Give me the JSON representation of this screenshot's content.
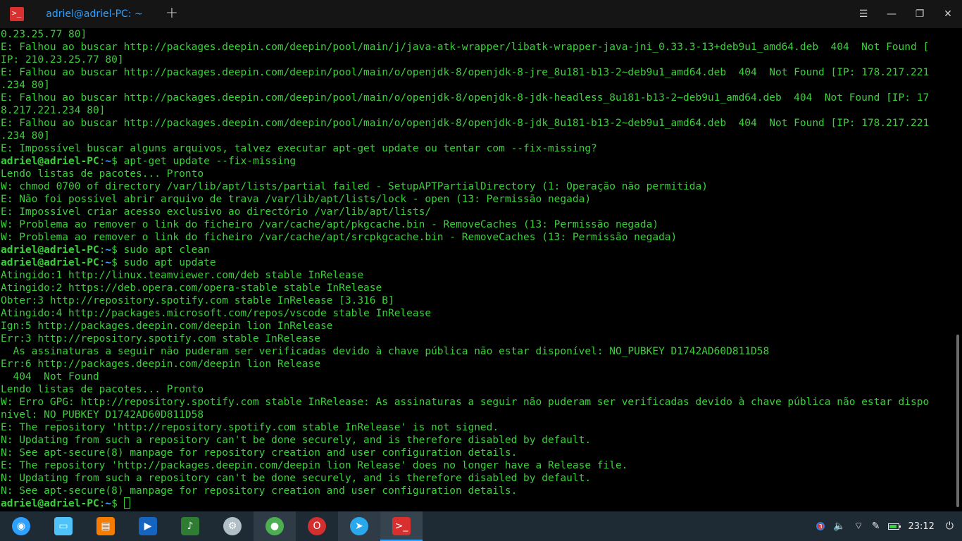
{
  "window": {
    "tab_title": "adriel@adriel-PC: ~",
    "new_tab_symbol": "+",
    "menu_symbol": "☰",
    "minimize_symbol": "—",
    "maximize_symbol": "❐",
    "close_symbol": "✕",
    "app_icon_glyph": ">_"
  },
  "terminal": {
    "lines": [
      {
        "text": "0.23.25.77 80]"
      },
      {
        "text": "E: Falhou ao buscar http://packages.deepin.com/deepin/pool/main/j/java-atk-wrapper/libatk-wrapper-java-jni_0.33.3-13+deb9u1_amd64.deb  404  Not Found ["
      },
      {
        "text": "IP: 210.23.25.77 80]"
      },
      {
        "text": "E: Falhou ao buscar http://packages.deepin.com/deepin/pool/main/o/openjdk-8/openjdk-8-jre_8u181-b13-2~deb9u1_amd64.deb  404  Not Found [IP: 178.217.221"
      },
      {
        "text": ".234 80]"
      },
      {
        "text": "E: Falhou ao buscar http://packages.deepin.com/deepin/pool/main/o/openjdk-8/openjdk-8-jdk-headless_8u181-b13-2~deb9u1_amd64.deb  404  Not Found [IP: 17"
      },
      {
        "text": "8.217.221.234 80]"
      },
      {
        "text": "E: Falhou ao buscar http://packages.deepin.com/deepin/pool/main/o/openjdk-8/openjdk-8-jdk_8u181-b13-2~deb9u1_amd64.deb  404  Not Found [IP: 178.217.221"
      },
      {
        "text": ".234 80]"
      },
      {
        "text": "E: Impossível buscar alguns arquivos, talvez executar apt-get update ou tentar com --fix-missing?"
      },
      {
        "prompt": true,
        "text": " apt-get update --fix-missing"
      },
      {
        "text": "Lendo listas de pacotes... Pronto"
      },
      {
        "text": "W: chmod 0700 of directory /var/lib/apt/lists/partial failed - SetupAPTPartialDirectory (1: Operação não permitida)"
      },
      {
        "text": "E: Não foi possível abrir arquivo de trava /var/lib/apt/lists/lock - open (13: Permissão negada)"
      },
      {
        "text": "E: Impossível criar acesso exclusivo ao directório /var/lib/apt/lists/"
      },
      {
        "text": "W: Problema ao remover o link do ficheiro /var/cache/apt/pkgcache.bin - RemoveCaches (13: Permissão negada)"
      },
      {
        "text": "W: Problema ao remover o link do ficheiro /var/cache/apt/srcpkgcache.bin - RemoveCaches (13: Permissão negada)"
      },
      {
        "prompt": true,
        "text": " sudo apt clean"
      },
      {
        "prompt": true,
        "text": " sudo apt update"
      },
      {
        "text": "Atingido:1 http://linux.teamviewer.com/deb stable InRelease"
      },
      {
        "text": "Atingido:2 https://deb.opera.com/opera-stable stable InRelease"
      },
      {
        "text": "Obter:3 http://repository.spotify.com stable InRelease [3.316 B]"
      },
      {
        "text": "Atingido:4 http://packages.microsoft.com/repos/vscode stable InRelease"
      },
      {
        "text": "Ign:5 http://packages.deepin.com/deepin lion InRelease"
      },
      {
        "text": "Err:3 http://repository.spotify.com stable InRelease"
      },
      {
        "text": "  As assinaturas a seguir não puderam ser verificadas devido à chave pública não estar disponível: NO_PUBKEY D1742AD60D811D58"
      },
      {
        "text": "Err:6 http://packages.deepin.com/deepin lion Release"
      },
      {
        "text": "  404  Not Found"
      },
      {
        "text": "Lendo listas de pacotes... Pronto"
      },
      {
        "text": "W: Erro GPG: http://repository.spotify.com stable InRelease: As assinaturas a seguir não puderam ser verificadas devido à chave pública não estar dispo"
      },
      {
        "text": "nível: NO_PUBKEY D1742AD60D811D58"
      },
      {
        "text": "E: The repository 'http://repository.spotify.com stable InRelease' is not signed."
      },
      {
        "text": "N: Updating from such a repository can't be done securely, and is therefore disabled by default."
      },
      {
        "text": "N: See apt-secure(8) manpage for repository creation and user configuration details."
      },
      {
        "text": "E: The repository 'http://packages.deepin.com/deepin lion Release' does no longer have a Release file."
      },
      {
        "text": "N: Updating from such a repository can't be done securely, and is therefore disabled by default."
      },
      {
        "text": "N: See apt-secure(8) manpage for repository creation and user configuration details."
      },
      {
        "prompt": true,
        "text": " ",
        "cursor": true
      }
    ],
    "prompt": {
      "user": "adriel@adriel-PC",
      "sep": ":",
      "path": "~",
      "symbol": "$"
    },
    "colors": {
      "text": "#3bd03b",
      "path": "#4fa3ff",
      "background": "#000000"
    }
  },
  "taskbar": {
    "apps": [
      {
        "name": "launcher",
        "icon": "deepin-launcher-icon",
        "glyph": "◉",
        "color": "#2ea0ff"
      },
      {
        "name": "file-manager",
        "icon": "folder-icon",
        "glyph": "▭",
        "color": "#4fc3f7"
      },
      {
        "name": "app-store",
        "icon": "store-icon",
        "glyph": "▤",
        "color": "#f57c00"
      },
      {
        "name": "video-player",
        "icon": "film-icon",
        "glyph": "▶",
        "color": "#1565c0"
      },
      {
        "name": "music-player",
        "icon": "music-icon",
        "glyph": "♪",
        "color": "#2e7d32"
      },
      {
        "name": "settings",
        "icon": "gear-icon",
        "glyph": "⚙",
        "color": "#b0bec5"
      },
      {
        "name": "chrome",
        "icon": "chrome-icon",
        "glyph": "●",
        "color": "#4caf50"
      },
      {
        "name": "opera",
        "icon": "opera-icon",
        "glyph": "O",
        "color": "#d32f2f"
      },
      {
        "name": "telegram",
        "icon": "telegram-icon",
        "glyph": "➤",
        "color": "#29a9eb"
      },
      {
        "name": "terminal",
        "icon": "terminal-icon",
        "glyph": ">_",
        "color": "#d9302f"
      }
    ],
    "tray": {
      "notification_count": "3",
      "volume_glyph": "🔈",
      "wifi_glyph": "⌔",
      "pen_glyph": "✎",
      "battery_level": 0.8,
      "power_glyph": "⏻",
      "time": "23:12"
    }
  }
}
